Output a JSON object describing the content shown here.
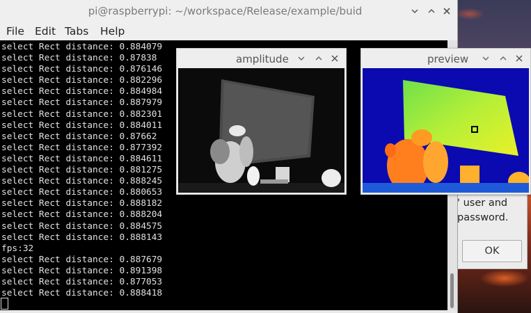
{
  "terminal": {
    "title": "pi@raspberrypi: ~/workspace/Release/example/buid",
    "menu": [
      "File",
      "Edit",
      "Tabs",
      "Help"
    ],
    "lines": [
      "select Rect distance: 0.884079",
      "select Rect distance: 0.87838",
      "select Rect distance: 0.876146",
      "select Rect distance: 0.882296",
      "select Rect distance: 0.884984",
      "select Rect distance: 0.887979",
      "select Rect distance: 0.882301",
      "select Rect distance: 0.884011",
      "select Rect distance: 0.87662",
      "select Rect distance: 0.877392",
      "select Rect distance: 0.884611",
      "select Rect distance: 0.881275",
      "select Rect distance: 0.888245",
      "select Rect distance: 0.880653",
      "select Rect distance: 0.888182",
      "select Rect distance: 0.888204",
      "select Rect distance: 0.884575",
      "select Rect distance: 0.888143",
      "fps:32",
      "select Rect distance: 0.887679",
      "select Rect distance: 0.891398",
      "select Rect distance: 0.877053",
      "select Rect distance: 0.888418"
    ]
  },
  "amplitude_window": {
    "title": "amplitude"
  },
  "preview_window": {
    "title": "preview"
  },
  "dialog": {
    "line1": "' user and",
    "line2": "password.",
    "ok_label": "OK"
  },
  "colors": {
    "terminal_bg": "#000000",
    "terminal_text": "#e0e0e0",
    "preview_bg": "#0a0ab0",
    "depth_near": "#ff7a1a",
    "depth_far": "#9cf03a"
  }
}
